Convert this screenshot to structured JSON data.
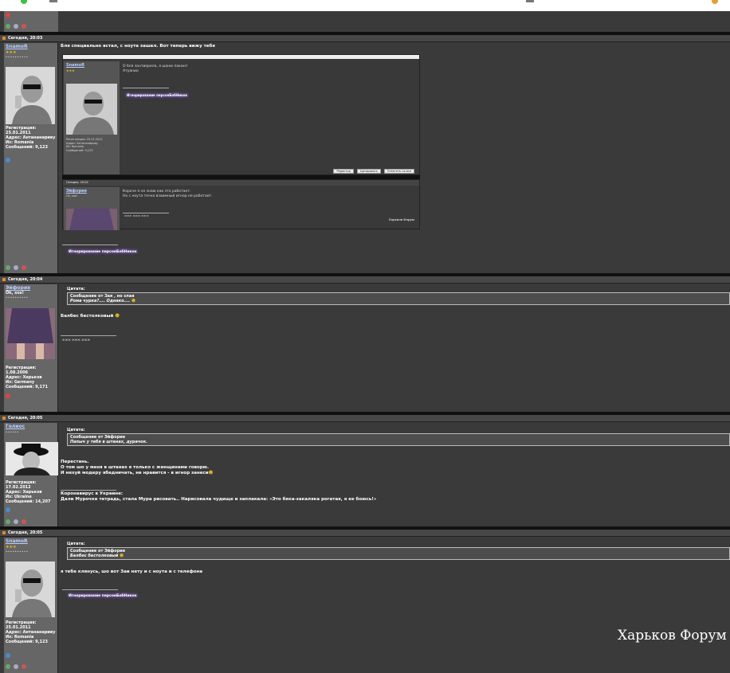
{
  "posts": [
    {
      "header": "Сегодня, 20:03",
      "author": "SnamoR",
      "rank": "★★★",
      "stars": "••••••••••",
      "reg_label": "Регистрация:",
      "reg_date": "25.01.2011",
      "addr": "Адрес: Антананариву",
      "from": "Из: Romania",
      "msgs": "Сообщений: 9,123",
      "text": "Бля специально встал, с ноута зашел. Вот теперь вижу тебя",
      "signature": "Игнорирование персонБобНикок",
      "embedded": {
        "post1": {
          "author": "SnamoR",
          "rank": "★★★",
          "line1": "О бля зантиорела, я шаню пакинт",
          "line2": "Атуанио",
          "reg": "Регистрация: 25.01.2011",
          "addr": "Адрес: Антананариву",
          "from": "Из: Romania",
          "msgs": "Сообщений: 9,123",
          "sig": "Игнорирование персонБобНикок",
          "btn1": "Редактир",
          "btn2": "Цитировать",
          "btn3": "Ответить на все"
        },
        "post2": {
          "header": "Сегодня, 20:02",
          "author": "Эйфория",
          "rank": "Ok, sos!",
          "line1": "Короче я не знаю как это работает.",
          "line2": "Но с ноута точно взаимный игнор не работает.",
          "sig": "жжж жжж жжж",
          "watermark": "Харьков Форум"
        }
      }
    },
    {
      "header": "Сегодня, 20:04",
      "author": "Эйфория",
      "rank": "Ok, sos!",
      "stars": "••••••••••",
      "reg_label": "Регистрация:",
      "reg_date": "1.08.2006",
      "addr": "Адрес: Харьков",
      "from": "Из: Germany",
      "msgs": "Сообщений: 9,171",
      "quote_label": "Цитата:",
      "quote_from_prefix": "Сообщение от ",
      "quote_from": "Зая , но злая",
      "quote_text": "Рома чурка?.... Однако....",
      "text": "Балбес бестолковый",
      "signature": "жжж жжж жжж"
    },
    {
      "header": "Сегодня, 20:05",
      "author": "Гелиос",
      "stars": "••••••",
      "reg_label": "Регистрация:",
      "reg_date": "17.02.2012",
      "addr": "Адрес: Харьков",
      "from": "Из: Ukraine",
      "msgs": "Сообщений: 14,207",
      "quote_label": "Цитата:",
      "quote_from_prefix": "Сообщение от ",
      "quote_from": "Эйфория",
      "quote_text": "Папыч у тебя в штанах, дурачок.",
      "text1": "Перестань.",
      "text2": "О том шо у меня в штанах я только с женщинами говорю.",
      "text3": "И нехуй модеру ябедничать, не нравится - в игнор занеси",
      "sig1": "Коронавирус в Украине:",
      "sig2": "Дали Мурочке тетрадь, стала Мура рисовать.. Нарисовала чудище и заплакала: «Это бяка-закаляка рогатая, я ее боюсь!»"
    },
    {
      "header": "Сегодня, 20:05",
      "author": "SnamoR",
      "rank": "★★★",
      "stars": "••••••••••",
      "reg_label": "Регистрация:",
      "reg_date": "25.01.2011",
      "addr": "Адрес: Антананариву",
      "from": "Из: Romania",
      "msgs": "Сообщений: 9,123",
      "quote_label": "Цитата:",
      "quote_from_prefix": "Сообщение от ",
      "quote_from": "Эйфория",
      "quote_text": "Балбес бестолковый",
      "text": "я тебе клянусь, шо вот Заи нету и с ноута и с телефона",
      "signature": "Игнорирование персонБобНикок"
    }
  ],
  "watermark": "Харьков Форум"
}
